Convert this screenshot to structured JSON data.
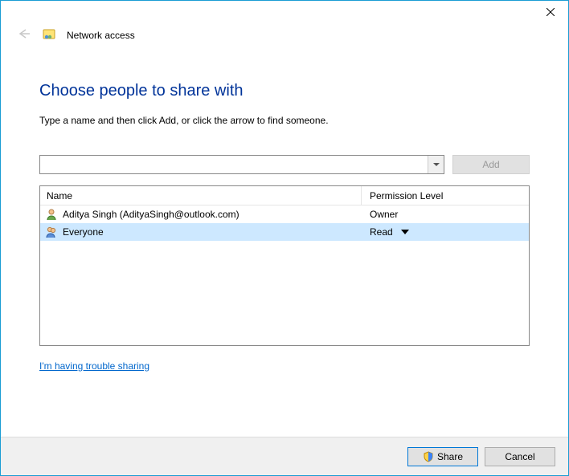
{
  "window": {
    "title": "Network access"
  },
  "heading": "Choose people to share with",
  "instruction": "Type a name and then click Add, or click the arrow to find someone.",
  "combo": {
    "value": "",
    "add_label": "Add"
  },
  "table": {
    "columns": {
      "name": "Name",
      "permission": "Permission Level"
    },
    "rows": [
      {
        "name": "Aditya Singh (AdityaSingh@outlook.com)",
        "permission": "Owner",
        "selected": false,
        "kind": "user"
      },
      {
        "name": "Everyone",
        "permission": "Read",
        "selected": true,
        "kind": "group"
      }
    ]
  },
  "help_link": "I'm having trouble sharing",
  "footer": {
    "share": "Share",
    "cancel": "Cancel"
  }
}
